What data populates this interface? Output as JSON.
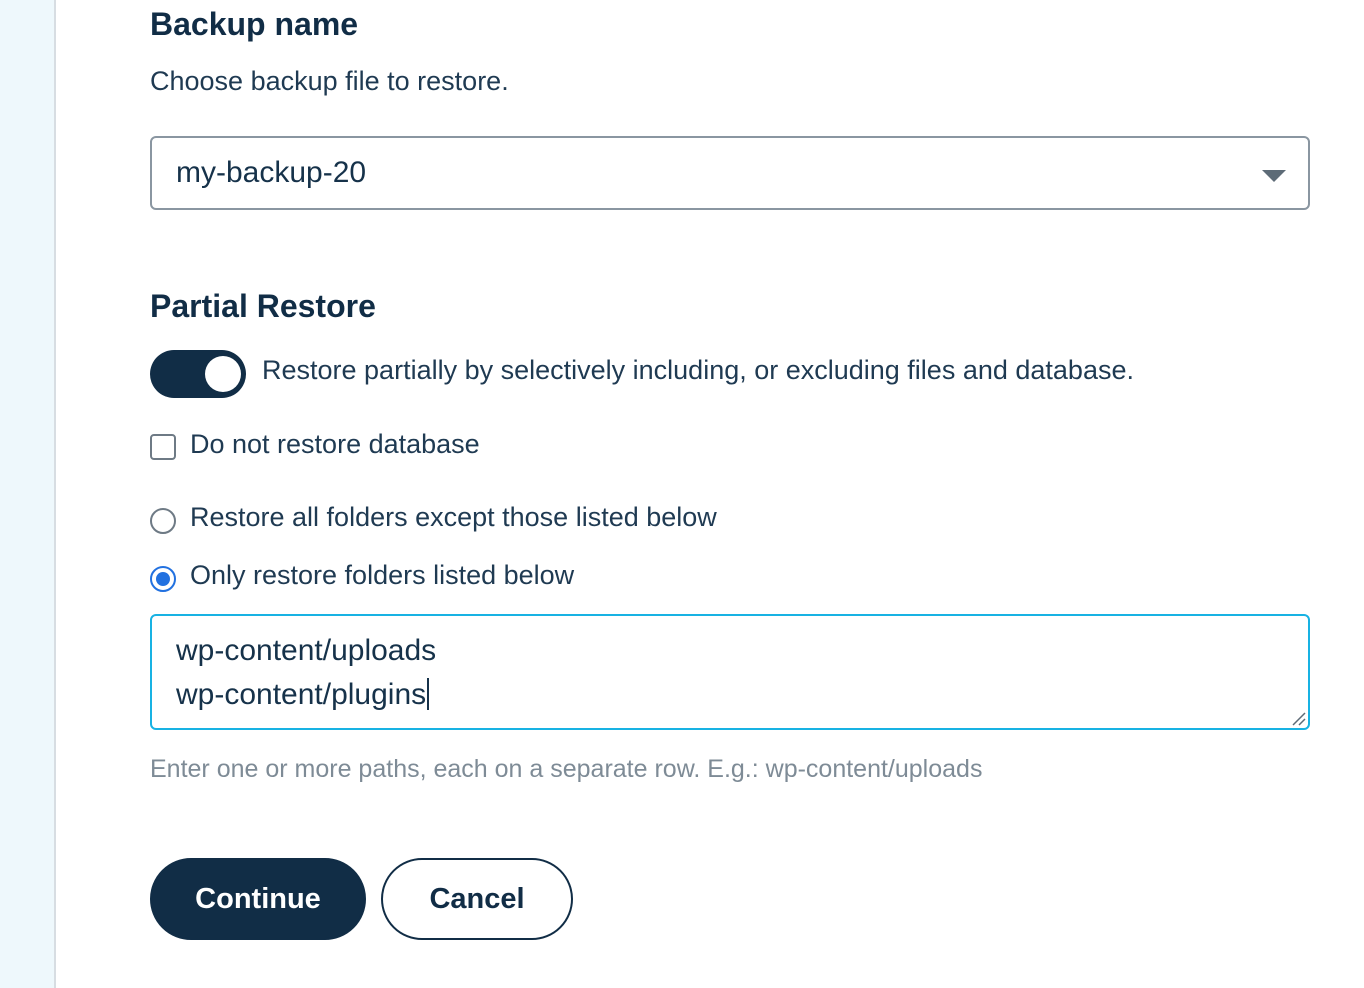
{
  "backup": {
    "title": "Backup name",
    "subtitle": "Choose backup file to restore.",
    "selected_backup": "my-backup-20"
  },
  "partial_restore": {
    "title": "Partial Restore",
    "toggle_label": "Restore partially by selectively including, or excluding files and database.",
    "toggle_on": true,
    "no_database_label": "Do not restore database",
    "no_database_checked": false,
    "radio_except_label": "Restore all folders except those listed below",
    "radio_only_label": "Only restore folders listed below",
    "selected_mode": "only",
    "paths": [
      "wp-content/uploads",
      "wp-content/plugins"
    ],
    "help_text": "Enter one or more paths, each on a separate row. E.g.: wp-content/uploads"
  },
  "actions": {
    "continue_label": "Continue",
    "cancel_label": "Cancel"
  },
  "colors": {
    "primary": "#112d46",
    "focus": "#18b2e3",
    "radio_selected": "#2271e0",
    "muted_text": "#7e8b96"
  }
}
